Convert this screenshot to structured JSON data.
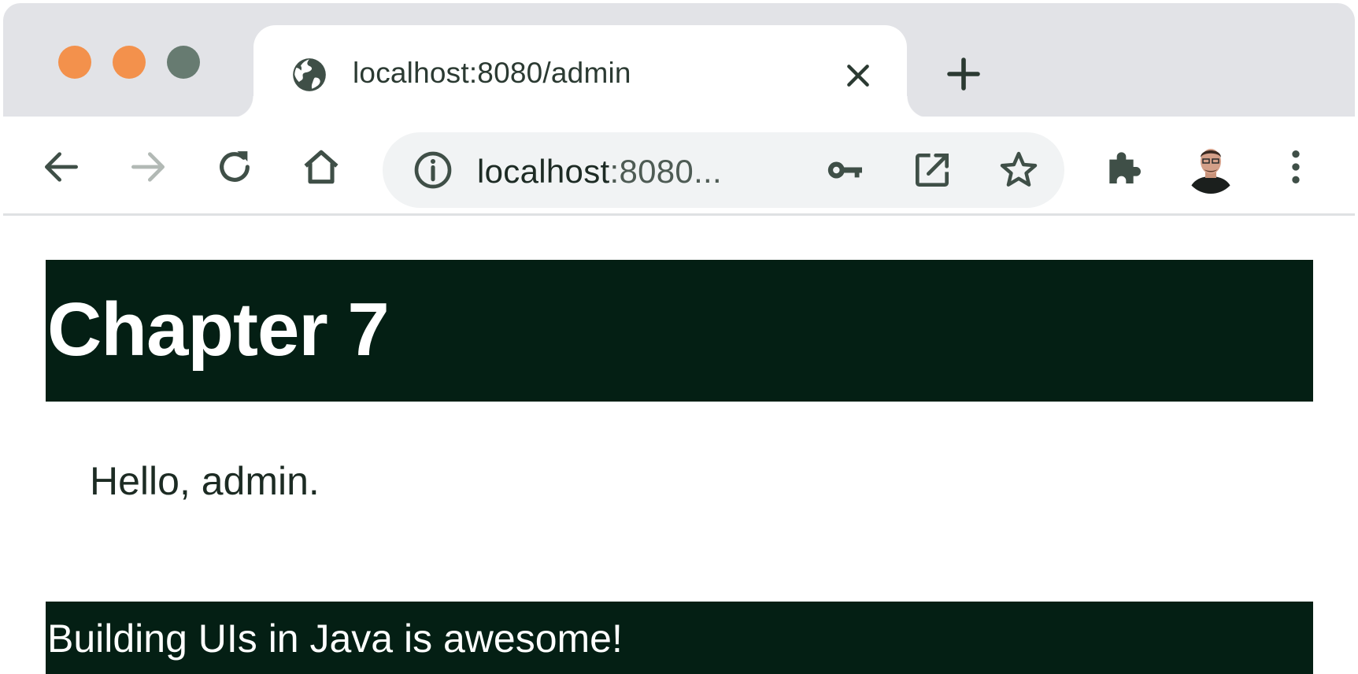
{
  "window": {
    "controls": [
      "close",
      "minimize",
      "maximize"
    ],
    "colors": {
      "close": "#f3914c",
      "minimize": "#f3914c",
      "maximize": "#677b71"
    }
  },
  "tab": {
    "title": "localhost:8080/admin",
    "favicon": "globe-icon",
    "close_icon": "close-icon"
  },
  "new_tab_icon": "plus-icon",
  "toolbar": {
    "back_icon": "arrow-left-icon",
    "forward_icon": "arrow-right-icon",
    "reload_icon": "reload-icon",
    "home_icon": "home-icon",
    "omnibox": {
      "site_info_icon": "info-icon",
      "url_host": "localhost",
      "url_rest": ":8080...",
      "password_icon": "key-icon",
      "open_in_app_icon": "open-external-icon",
      "bookmark_icon": "star-icon"
    },
    "extensions_icon": "puzzle-icon",
    "profile_icon": "avatar",
    "menu_icon": "more-vertical-icon"
  },
  "page": {
    "header_title": "Chapter 7",
    "greeting": "Hello, admin.",
    "footer_text": "Building UIs in Java is awesome!",
    "colors": {
      "bar_background": "#041f14",
      "bar_text": "#ffffff",
      "body_text": "#1c2b23"
    }
  }
}
